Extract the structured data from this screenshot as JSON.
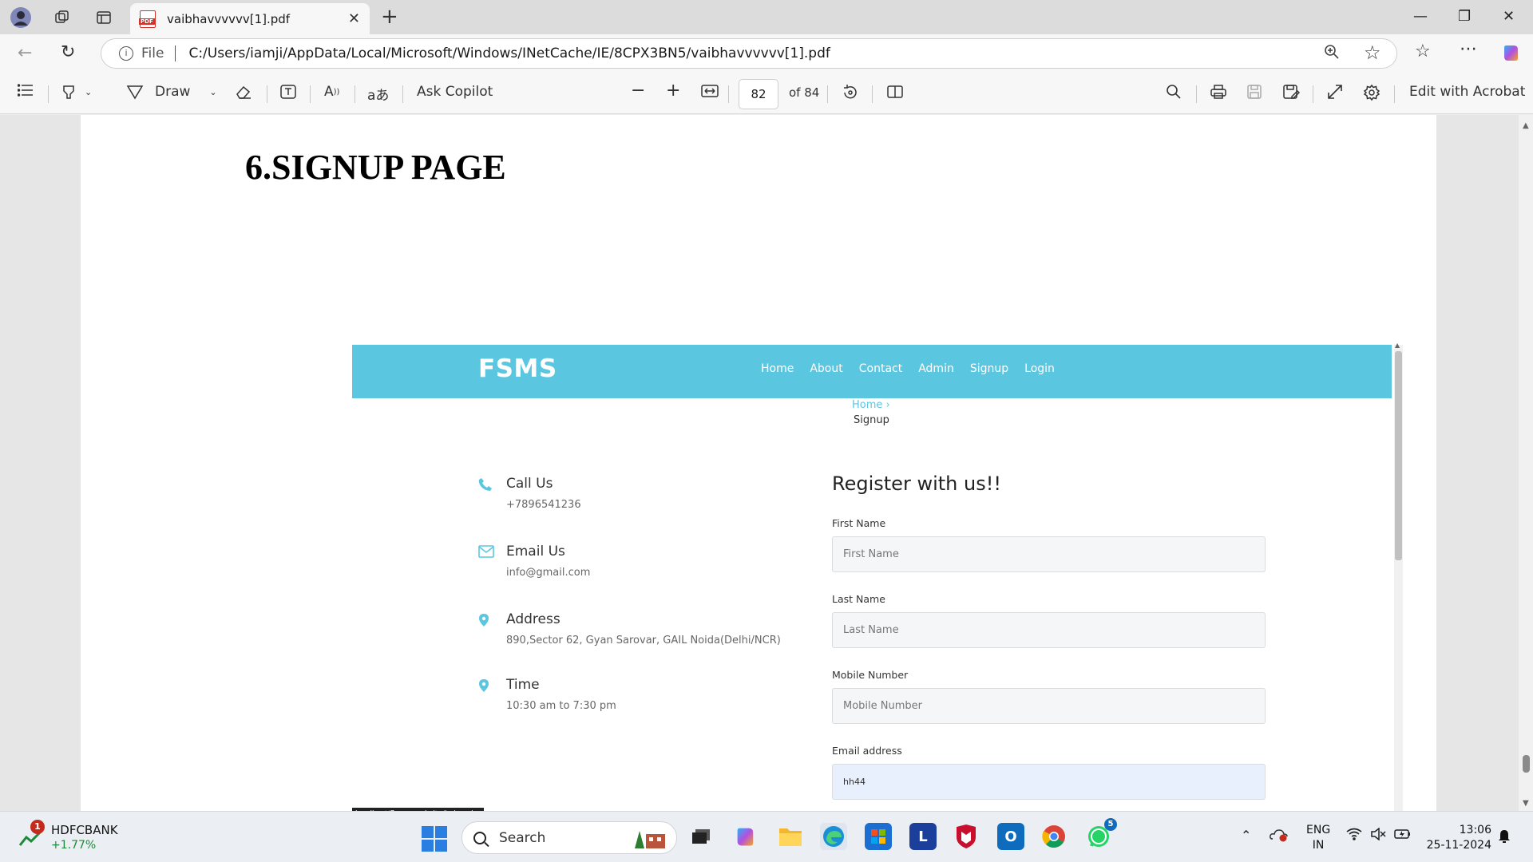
{
  "browser": {
    "tab_title": "vaibhavvvvvv[1].pdf",
    "tab_icon": "pdf-icon",
    "address_scheme": "File",
    "url": "C:/Users/iamji/AppData/Local/Microsoft/Windows/INetCache/IE/8CPX3BN5/vaibhavvvvvv[1].pdf"
  },
  "pdf_toolbar": {
    "draw_label": "Draw",
    "copilot_label": "Ask Copilot",
    "page_current": "82",
    "page_total": "of 84",
    "acrobat_label": "Edit with Acrobat"
  },
  "pdf_page": {
    "heading": "6.SIGNUP PAGE"
  },
  "site": {
    "logo": "FSMS",
    "brand_color": "#5bc6e0",
    "nav": [
      "Home",
      "About",
      "Contact",
      "Admin",
      "Signup",
      "Login"
    ],
    "breadcrumb_home": "Home ›",
    "breadcrumb_current": "Signup",
    "contact": [
      {
        "title": "Call Us",
        "value": "+7896541236",
        "icon": "phone-icon"
      },
      {
        "title": "Email Us",
        "value": "info@gmail.com",
        "icon": "envelope-icon"
      },
      {
        "title": "Address",
        "value": "890,Sector 62, Gyan Sarovar, GAIL Noida(Delhi/NCR)",
        "icon": "location-pin-icon"
      },
      {
        "title": "Time",
        "value": "10:30 am to 7:30 pm",
        "icon": "location-pin-icon"
      }
    ],
    "form": {
      "title": "Register with us!!",
      "fields": [
        {
          "label": "First Name",
          "placeholder": "First Name",
          "value": ""
        },
        {
          "label": "Last Name",
          "placeholder": "Last Name",
          "value": ""
        },
        {
          "label": "Mobile Number",
          "placeholder": "Mobile Number",
          "value": ""
        },
        {
          "label": "Email address",
          "placeholder": "",
          "value": "hh44"
        }
      ]
    },
    "status_url": "localhost/flower website/index.php"
  },
  "taskbar": {
    "stock_name": "HDFCBANK",
    "stock_change": "+1.77%",
    "stock_badge": "1",
    "search_label": "Search",
    "whatsapp_badge": "5",
    "lang_line1": "ENG",
    "lang_line2": "IN",
    "time": "13:06",
    "date": "25-11-2024"
  }
}
